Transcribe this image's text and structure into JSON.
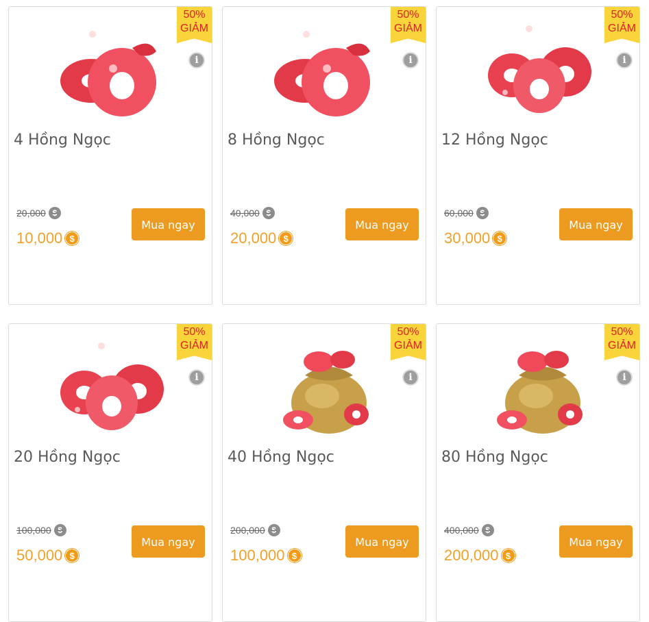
{
  "currency_symbol": "$",
  "products": [
    {
      "discount_pct": "50%",
      "discount_word": "GIẢM",
      "title": "4 Hồng Ngọc",
      "old_price": "20,000",
      "new_price": "10,000",
      "buy_label": "Mua ngay",
      "image": "ruby-coins-pair"
    },
    {
      "discount_pct": "50%",
      "discount_word": "GIẢM",
      "title": "8 Hồng Ngọc",
      "old_price": "40,000",
      "new_price": "20,000",
      "buy_label": "Mua ngay",
      "image": "ruby-coins-pair"
    },
    {
      "discount_pct": "50%",
      "discount_word": "GIẢM",
      "title": "12 Hồng Ngọc",
      "old_price": "60,000",
      "new_price": "30,000",
      "buy_label": "Mua ngay",
      "image": "ruby-coins-trio"
    },
    {
      "discount_pct": "50%",
      "discount_word": "GIẢM",
      "title": "20 Hồng Ngọc",
      "old_price": "100,000",
      "new_price": "50,000",
      "buy_label": "Mua ngay",
      "image": "ruby-coins-trio"
    },
    {
      "discount_pct": "50%",
      "discount_word": "GIẢM",
      "title": "40 Hồng Ngọc",
      "old_price": "200,000",
      "new_price": "100,000",
      "buy_label": "Mua ngay",
      "image": "ruby-gold-bag"
    },
    {
      "discount_pct": "50%",
      "discount_word": "GIẢM",
      "title": "80 Hồng Ngọc",
      "old_price": "400,000",
      "new_price": "200,000",
      "buy_label": "Mua ngay",
      "image": "ruby-gold-bag"
    }
  ],
  "colors": {
    "accent": "#ec9a20",
    "price": "#f0a12a",
    "ribbon": "#f9d43a",
    "ribbon_text": "#dd2222",
    "ruby": "#f04a5a"
  }
}
